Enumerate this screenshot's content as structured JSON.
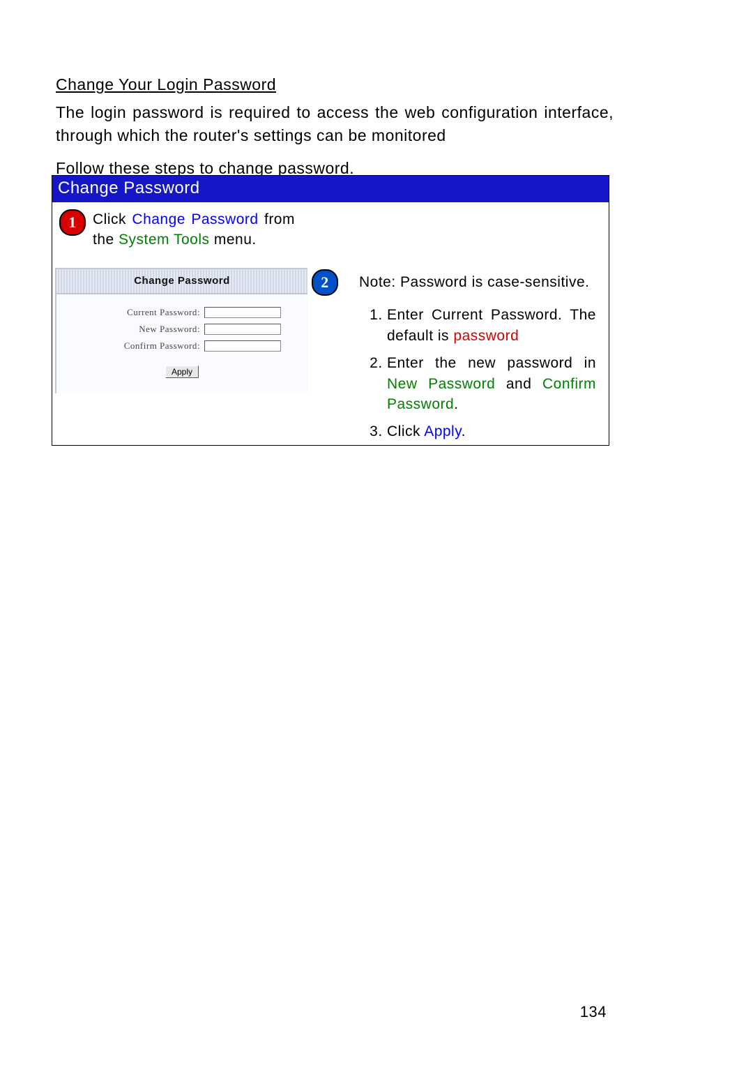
{
  "heading": "Change Your Login Password",
  "intro1": "The login password is required to access the web configuration interface, through which the router's settings can be monitored",
  "intro2": "Follow these steps to change password.",
  "box_title": "Change Password",
  "step1": {
    "badge": "1",
    "pre": "Click ",
    "link": "Change Password",
    "mid": " from the ",
    "menu": "System Tools",
    "post": " menu."
  },
  "shot": {
    "title": "Change Password",
    "labels": {
      "current": "Current Password:",
      "new": "New Password:",
      "confirm": "Confirm Password:"
    },
    "apply": "Apply"
  },
  "step2_badge": "2",
  "note": "Note: Password is case-sensitive.",
  "list": {
    "li1a": "Enter Current Password. The default is ",
    "li1b": "password",
    "li2a": "Enter the new password in ",
    "li2b": "New Password",
    "li2c": " and ",
    "li2d": "Confirm Password",
    "li2e": ".",
    "li3a": "Click ",
    "li3b": "Apply",
    "li3c": "."
  },
  "page_number": "134"
}
